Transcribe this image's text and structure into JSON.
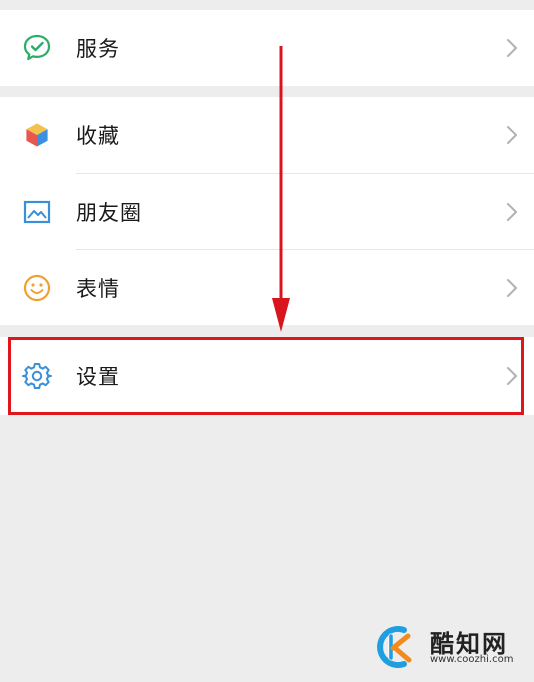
{
  "menu": {
    "services": {
      "label": "服务",
      "icon": "wechat-pay-icon"
    },
    "favorites": {
      "label": "收藏",
      "icon": "cube-icon"
    },
    "moments": {
      "label": "朋友圈",
      "icon": "image-icon"
    },
    "stickers": {
      "label": "表情",
      "icon": "smiley-icon"
    },
    "settings": {
      "label": "设置",
      "icon": "gear-icon"
    }
  },
  "colors": {
    "highlight": "#e0161d",
    "arrow": "#d8141c",
    "services_icon": "#2aae67",
    "moments_icon": "#3a8fd8",
    "stickers_icon": "#f0a030",
    "settings_icon": "#3a8fd8"
  },
  "watermark": {
    "name": "酷知网",
    "url": "www.coozhi.com"
  }
}
